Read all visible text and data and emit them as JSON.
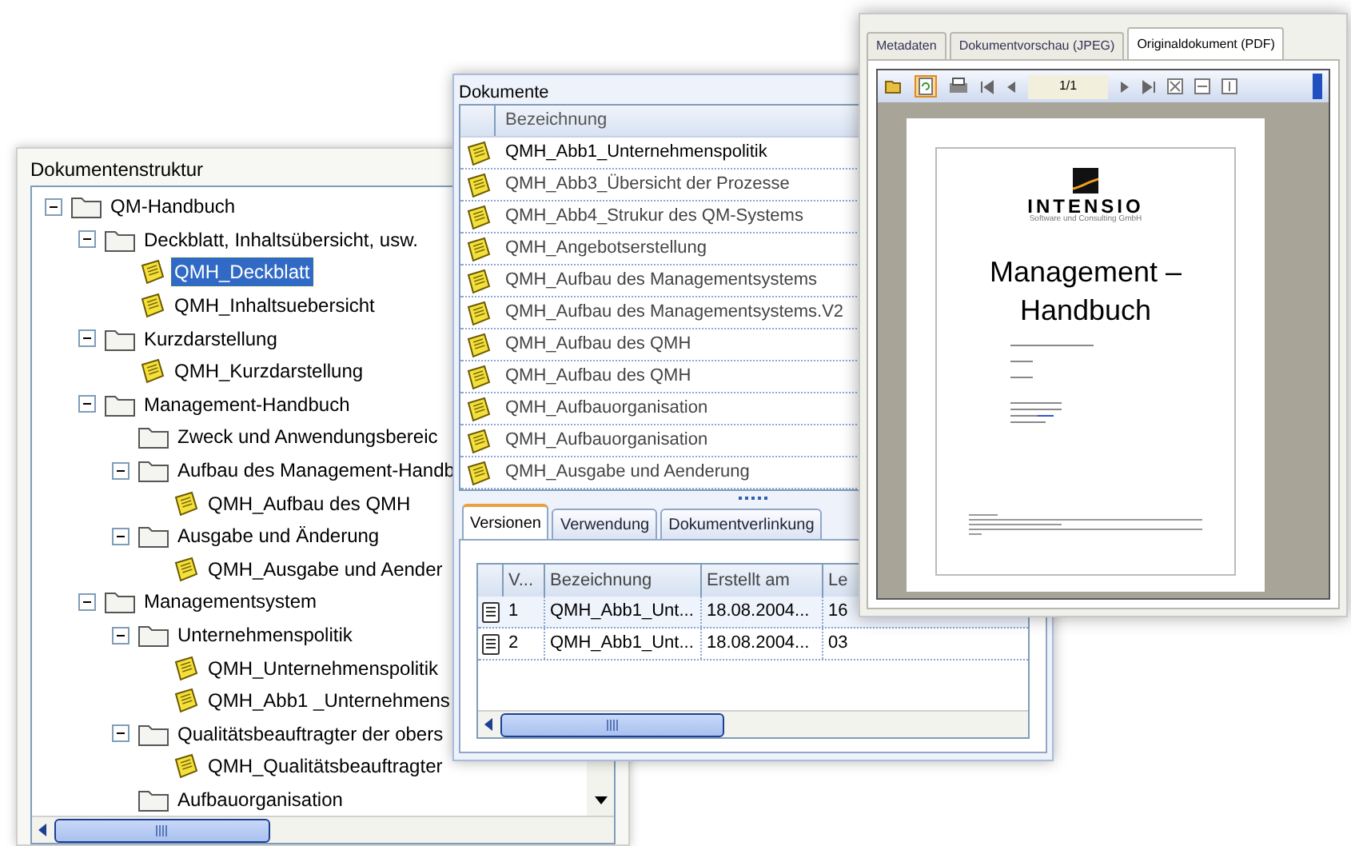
{
  "structure_window": {
    "title": "Dokumentenstruktur",
    "tree": [
      {
        "kind": "folder",
        "label": "QM-Handbuch",
        "expanded": true,
        "selected": false,
        "children": [
          {
            "kind": "folder",
            "label": "Deckblatt, Inhaltsübersicht, usw.",
            "expanded": true,
            "selected": false,
            "children": [
              {
                "kind": "document",
                "label": "QMH_Deckblatt",
                "selected": true
              },
              {
                "kind": "document",
                "label": "QMH_Inhaltsuebersicht",
                "selected": false
              }
            ]
          },
          {
            "kind": "folder",
            "label": "Kurzdarstellung",
            "expanded": true,
            "selected": false,
            "children": [
              {
                "kind": "document",
                "label": "QMH_Kurzdarstellung",
                "selected": false
              }
            ]
          },
          {
            "kind": "folder",
            "label": "Management-Handbuch",
            "expanded": true,
            "selected": false,
            "children": [
              {
                "kind": "folder",
                "label": "Zweck und Anwendungsbereic",
                "selected": false
              },
              {
                "kind": "folder",
                "label": "Aufbau des Management-Handb",
                "expanded": true,
                "selected": false,
                "children": [
                  {
                    "kind": "document",
                    "label": "QMH_Aufbau des QMH",
                    "selected": false
                  }
                ]
              },
              {
                "kind": "folder",
                "label": "Ausgabe und Änderung",
                "expanded": true,
                "selected": false,
                "children": [
                  {
                    "kind": "document",
                    "label": "QMH_Ausgabe und Aender",
                    "selected": false
                  }
                ]
              }
            ]
          },
          {
            "kind": "folder",
            "label": "Managementsystem",
            "expanded": true,
            "selected": false,
            "children": [
              {
                "kind": "folder",
                "label": "Unternehmenspolitik",
                "expanded": true,
                "selected": false,
                "children": [
                  {
                    "kind": "document",
                    "label": "QMH_Unternehmenspolitik",
                    "selected": false
                  },
                  {
                    "kind": "document",
                    "label": "QMH_Abb1 _Unternehmens",
                    "selected": false
                  }
                ]
              },
              {
                "kind": "folder",
                "label": "Qualitätsbeauftragter der obers",
                "expanded": true,
                "selected": false,
                "children": [
                  {
                    "kind": "document",
                    "label": "QMH_Qualitätsbeauftragter",
                    "selected": false
                  }
                ]
              },
              {
                "kind": "folder",
                "label": "Aufbauorganisation",
                "selected": false
              }
            ]
          }
        ]
      }
    ]
  },
  "documents_window": {
    "title": "Dokumente",
    "column": "Bezeichnung",
    "rows": [
      "QMH_Abb1_Unternehmenspolitik",
      "QMH_Abb3_Übersicht der Prozesse",
      "QMH_Abb4_Strukur des QM-Systems",
      "QMH_Angebotserstellung",
      "QMH_Aufbau des Managementsystems",
      "QMH_Aufbau des Managementsystems.V2",
      "QMH_Aufbau des QMH",
      "QMH_Aufbau des QMH",
      "QMH_Aufbauorganisation",
      "QMH_Aufbauorganisation",
      "QMH_Ausgabe und Aenderung"
    ],
    "tabs": [
      {
        "label": "Versionen",
        "selected": true
      },
      {
        "label": "Verwendung",
        "selected": false
      },
      {
        "label": "Dokumentverlinkung",
        "selected": false
      }
    ],
    "versions": {
      "columns": [
        "V...",
        "Bezeichnung",
        "Erstellt am",
        "Le"
      ],
      "rows": [
        [
          "1",
          "QMH_Abb1_Unt...",
          "18.08.2004...",
          "16"
        ],
        [
          "2",
          "QMH_Abb1_Unt...",
          "18.08.2004...",
          "03"
        ]
      ]
    }
  },
  "preview_window": {
    "tabs": [
      {
        "label": "Metadaten",
        "selected": false
      },
      {
        "label": "Dokumentvorschau (JPEG)",
        "selected": false
      },
      {
        "label": "Originaldokument (PDF)",
        "selected": true
      }
    ],
    "page_indicator": "1/1",
    "document": {
      "logo": "INTENSIO",
      "subtitle": "Software und Consulting GmbH",
      "heading_1": "Management –",
      "heading_2": "Handbuch"
    }
  }
}
